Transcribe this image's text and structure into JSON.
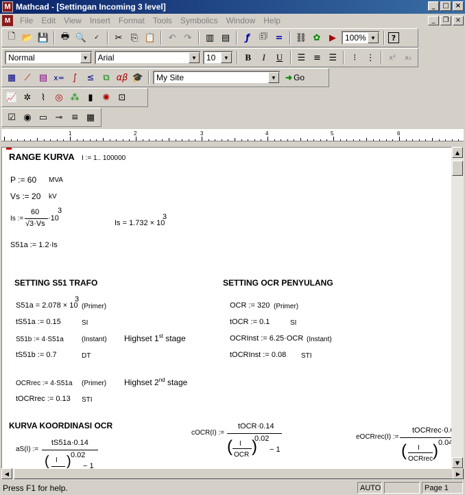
{
  "window": {
    "title": "Mathcad - [Settingan Incoming 3 level]",
    "app_glyph": "M"
  },
  "menu": [
    "File",
    "Edit",
    "View",
    "Insert",
    "Format",
    "Tools",
    "Symbolics",
    "Window",
    "Help"
  ],
  "toolbar": {
    "zoom": "100%",
    "style": "Normal",
    "font": "Arial",
    "size": "10",
    "url": "My Site",
    "go_label": "Go"
  },
  "ruler": {
    "numbers": [
      "1",
      "2",
      "3",
      "4",
      "5",
      "6"
    ]
  },
  "worksheet": {
    "range_heading": "RANGE KURVA",
    "range_def": "I := 1.. 100000",
    "p_def": "P := 60",
    "p_unit": "MVA",
    "vs_def": "Vs := 20",
    "vs_unit": "kV",
    "is_lhs": "Is :=",
    "is_num": "60",
    "is_den": "√3·Vs",
    "is_mult": "·10",
    "is_exp": "3",
    "is_result": "Is = 1.732 × 10",
    "is_result_exp": "3",
    "s51a_def": "S51a := 1.2·Is",
    "s51_heading": "SETTING S51 TRAFO",
    "ocr_heading": "SETTING OCR PENYULANG",
    "s51a_result": "S51a = 2.078 × 10",
    "s51a_result_exp": "3",
    "s51a_note": "(Primer)",
    "ts51a_def": "tS51a := 0.15",
    "ts51a_note": "SI",
    "s51b_def": "S51b := 4·S51a",
    "s51b_note": "(Instant)",
    "highset1_pre": "Highset 1",
    "highset1_sup": "st",
    "highset1_post": " stage",
    "ts51b_def": "tS51b := 0.7",
    "ts51b_note": "DT",
    "ocrrec_def": "OCRrec := 4·S51a",
    "ocrrec_note": "(Primer)",
    "highset2_pre": "Highset 2",
    "highset2_sup": "nd",
    "highset2_post": " stage",
    "tocrrec_def": "tOCRrec := 0.13",
    "tocrrec_note": "STI",
    "ocr_def": "OCR := 320",
    "ocr_note": "(Primer)",
    "tocr_def": "tOCR := 0.1",
    "tocr_note": "SI",
    "ocrinst_def": "OCRInst := 6.25·OCR",
    "ocrinst_note": "(Instant)",
    "tocrinst_def": "tOCRInst := 0.08",
    "tocrinst_note": "STI",
    "kurva_heading": "KURVA KOORDINASI OCR",
    "as_lhs": "aS(I) :=",
    "as_num": "tS51a·0.14",
    "as_inner_num": "I",
    "as_minus": "− 1",
    "exp_002": "0.02",
    "cocr_lhs": "cOCR(I) :=",
    "cocr_num": "tOCR·0.14",
    "cocr_inner_num": "I",
    "cocr_inner_den": "OCR",
    "cocr_minus": "− 1",
    "eocr_lhs": "eOCRrec(I) :=",
    "eocr_num": "tOCRrec·0.0",
    "eocr_inner_num": "I",
    "eocr_inner_den": "OCRrec",
    "eocr_exp": "0.04"
  },
  "status": {
    "message": "Press F1 for help.",
    "mode": "AUTO",
    "page": "Page 1"
  }
}
